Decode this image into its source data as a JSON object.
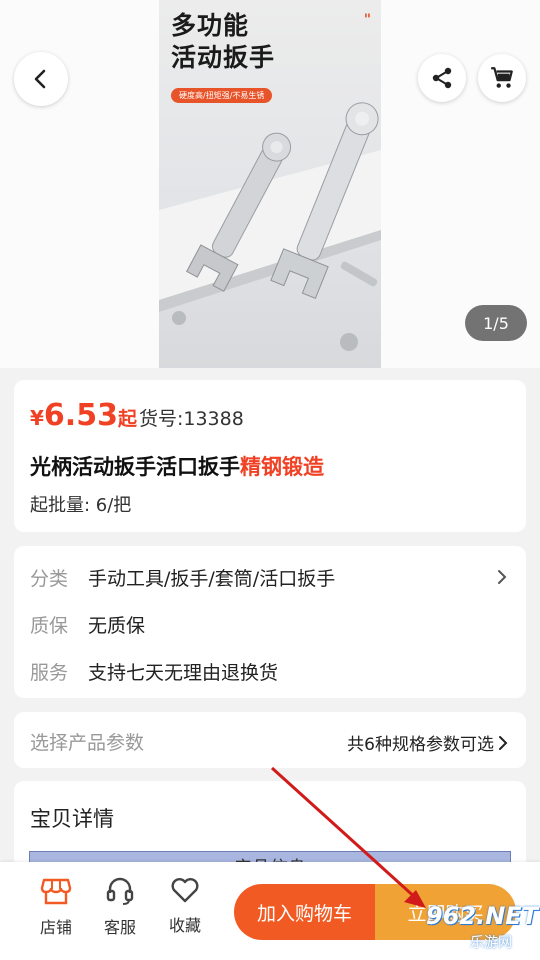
{
  "hero": {
    "image_title_line1": "多功能",
    "image_title_line2": "活动扳手",
    "image_badge": "硬度高/扭矩强/不易生锈",
    "image_mark": "\"",
    "pager": "1/5"
  },
  "product": {
    "currency": "¥",
    "price": "6.53",
    "price_suffix": "起",
    "sku": "货号:13388",
    "title_main": "光柄活动扳手活口扳手",
    "title_highlight": "精钢锻造",
    "moq": "起批量: 6/把"
  },
  "info": {
    "category_key": "分类",
    "category_value": "手动工具/扳手/套筒/活口扳手",
    "warranty_key": "质保",
    "warranty_value": "无质保",
    "service_key": "服务",
    "service_value": "支持七天无理由退换货"
  },
  "spec": {
    "label": "选择产品参数",
    "summary": "共6种规格参数可选"
  },
  "detail": {
    "title": "宝贝详情",
    "table_header": "产品信息"
  },
  "bottom": {
    "store": "店铺",
    "service": "客服",
    "favorite": "收藏",
    "add_to_cart": "加入购物车",
    "buy_now": "立即购买"
  },
  "watermark": {
    "brand": "962.NET",
    "sub": "乐游网"
  },
  "colors": {
    "accent": "#f04124",
    "cart_button": "#f15a22",
    "buy_button": "#f0a235",
    "icon_orange": "#f15a22"
  },
  "icons": [
    "back-arrow-icon",
    "share-icon",
    "cart-icon",
    "chevron-right-icon",
    "store-icon",
    "headset-icon",
    "heart-icon",
    "annotation-arrow"
  ]
}
